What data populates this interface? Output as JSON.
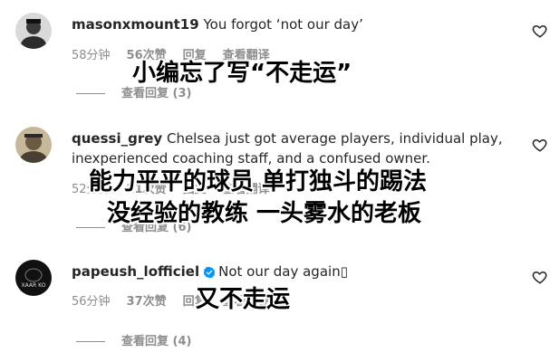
{
  "comments": [
    {
      "username": "masonxmount19",
      "text": "You forgot ‘not our day’",
      "time": "58分钟",
      "likes": "56次赞",
      "reply": "回复",
      "translate": "查看翻译",
      "view_replies": "查看回复 (3)"
    },
    {
      "username": "quessi_grey",
      "text": "Chelsea just got average players, individual play, inexperienced coaching staff, and a confused owner.",
      "time": "52分钟",
      "likes": "21次赞",
      "reply": "回复",
      "translate": "查看翻译",
      "view_replies": "查看回复 (6)"
    },
    {
      "username": "papeush_lofficiel",
      "text": "Not our day again▯",
      "time": "56分钟",
      "likes": "37次赞",
      "reply": "回复",
      "translate": "查看翻译",
      "view_replies": "查看回复 (4)",
      "avatar_text": "XAAR KO"
    }
  ],
  "overlays": {
    "first": "小编忘了写“不走运”",
    "second_line1": "能力平平的球员 单打独斗的踢法",
    "second_line2": "没经验的教练 一头雾水的老板",
    "third": "又不走运"
  },
  "icons": {
    "heart": "heart-outline-icon",
    "verified": "verified-badge-icon"
  },
  "colors": {
    "text": "#262626",
    "muted": "#8e8e8e",
    "verified": "#0095f6"
  }
}
